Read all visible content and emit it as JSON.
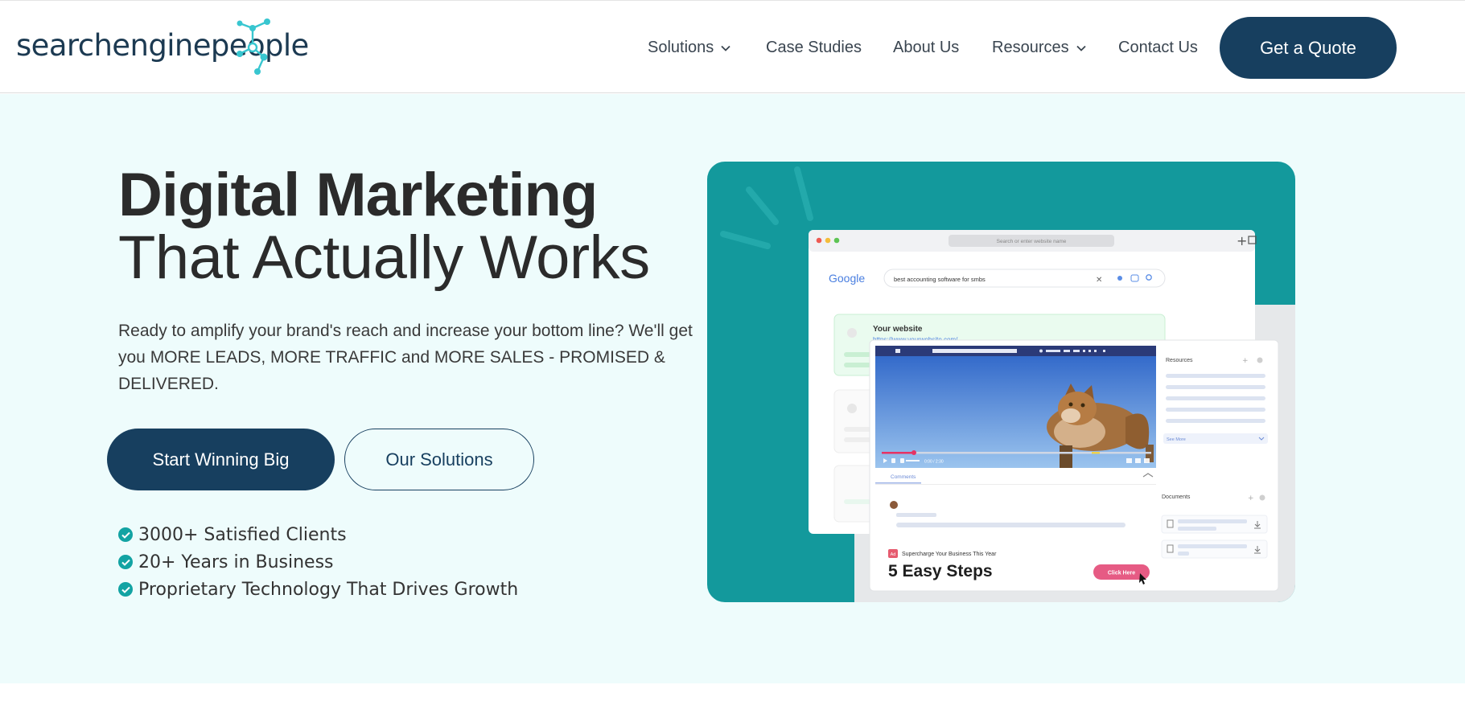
{
  "brand": {
    "logo_text": "searchenginepeople"
  },
  "nav": {
    "items": [
      {
        "label": "Solutions",
        "has_dropdown": true
      },
      {
        "label": "Case Studies",
        "has_dropdown": false
      },
      {
        "label": "About Us",
        "has_dropdown": false
      },
      {
        "label": "Resources",
        "has_dropdown": true
      },
      {
        "label": "Contact Us",
        "has_dropdown": false
      }
    ],
    "cta": "Get a Quote"
  },
  "hero": {
    "title_bold": "Digital Marketing",
    "title_light": "That Actually Works",
    "lead": "Ready to amplify your brand's reach and increase your bottom line? We'll get you MORE LEADS, MORE TRAFFIC and MORE SALES - PROMISED & DELIVERED.",
    "primary_cta": "Start Winning Big",
    "secondary_cta": "Our Solutions",
    "checks": [
      "3000+ Satisfied Clients",
      "20+ Years in Business",
      "Proprietary Technology That Drives Growth"
    ]
  },
  "mockup": {
    "address_bar": "Search or enter website name",
    "google_logo": "Google",
    "search_query": "best accounting software for smbs",
    "result_title": "Your website",
    "result_url": "https://www.yourwebsite.com/",
    "sidebar_resources": "Resources",
    "sidebar_see_more": "See More",
    "sidebar_documents": "Documents",
    "comments_tab": "Comments",
    "ad_badge": "Ad",
    "ad_title": "Supercharge Your Business This Year",
    "ad_headline": "5 Easy Steps",
    "ad_button": "Click Here",
    "video_time": "0:00 / 2:30"
  },
  "colors": {
    "navy": "#173f5f",
    "teal": "#13999c",
    "hero_bg": "#eefcfc",
    "logo_accent": "#38c6d0"
  },
  "icons": [
    "chevron-down-icon",
    "check-circle-icon",
    "globe-icon",
    "search-icon",
    "close-icon",
    "mic-icon",
    "plus-icon",
    "share-icon",
    "download-icon",
    "document-icon"
  ]
}
